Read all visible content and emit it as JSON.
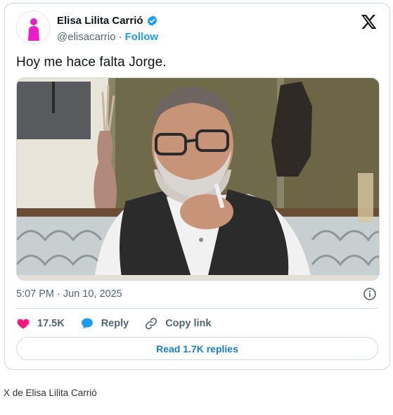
{
  "tweet": {
    "author_name": "Elisa Lilita Carrió",
    "handle": "@elisacarrio",
    "separator": "·",
    "follow_label": "Follow",
    "text": "Hoy me hace falta Jorge.",
    "timestamp": "5:07 PM · Jun 10, 2025",
    "likes_count": "17.5K",
    "reply_label": "Reply",
    "copy_link_label": "Copy link",
    "read_replies_label": "Read 1.7K replies"
  },
  "caption": "X de Elisa Lilita Carrió",
  "icons": {
    "verified": "verified-badge-icon",
    "x_logo": "x-logo-icon",
    "info": "info-icon",
    "like": "heart-icon",
    "reply": "speech-bubble-icon",
    "copy_link": "link-icon"
  },
  "colors": {
    "accent": "#1d9bf0",
    "like": "#f91880",
    "avatar_figure": "#e81fc7"
  }
}
